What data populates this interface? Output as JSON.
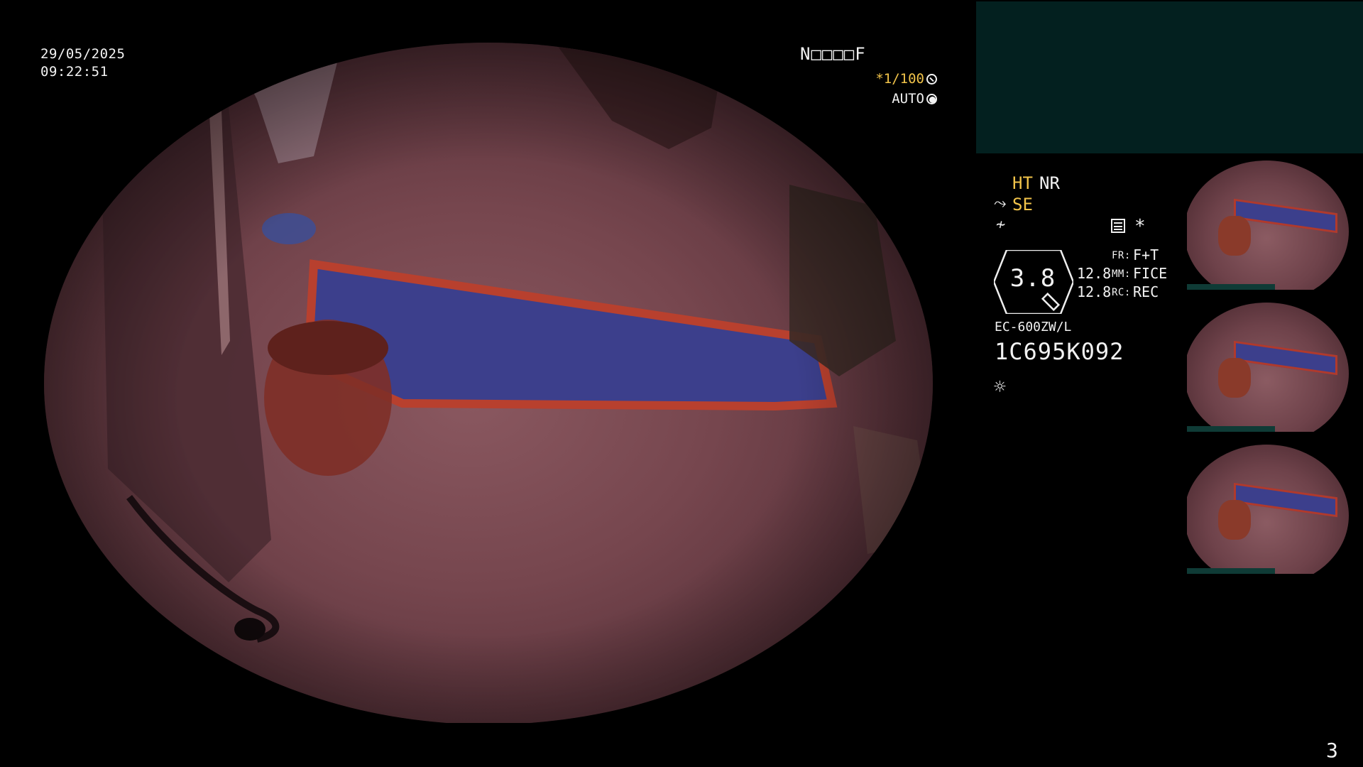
{
  "overlay": {
    "date": "29/05/2025",
    "time": "09:22:51",
    "flag": "N□□□□F",
    "shutter": "*1/100",
    "auto": "AUTO"
  },
  "panel": {
    "ht": "HT",
    "nr": "NR",
    "se": "SE",
    "zoom": "3.8",
    "value_top": "12.8",
    "value_bottom": "12.8",
    "fr_label": "FR:",
    "fr_value": "F+T",
    "mm_label": "MM:",
    "mm_value": "FICE",
    "rc_label": "RC:",
    "rc_value": "REC",
    "star": "*",
    "model": "EC-600ZW/L",
    "serial": "1C695K092"
  },
  "page_number": "3",
  "colors": {
    "accent_yellow": "#f2c44a",
    "teal_box": "#03201f",
    "stripe_blue": "#3c3f8c",
    "stripe_red": "#b03a2c"
  }
}
